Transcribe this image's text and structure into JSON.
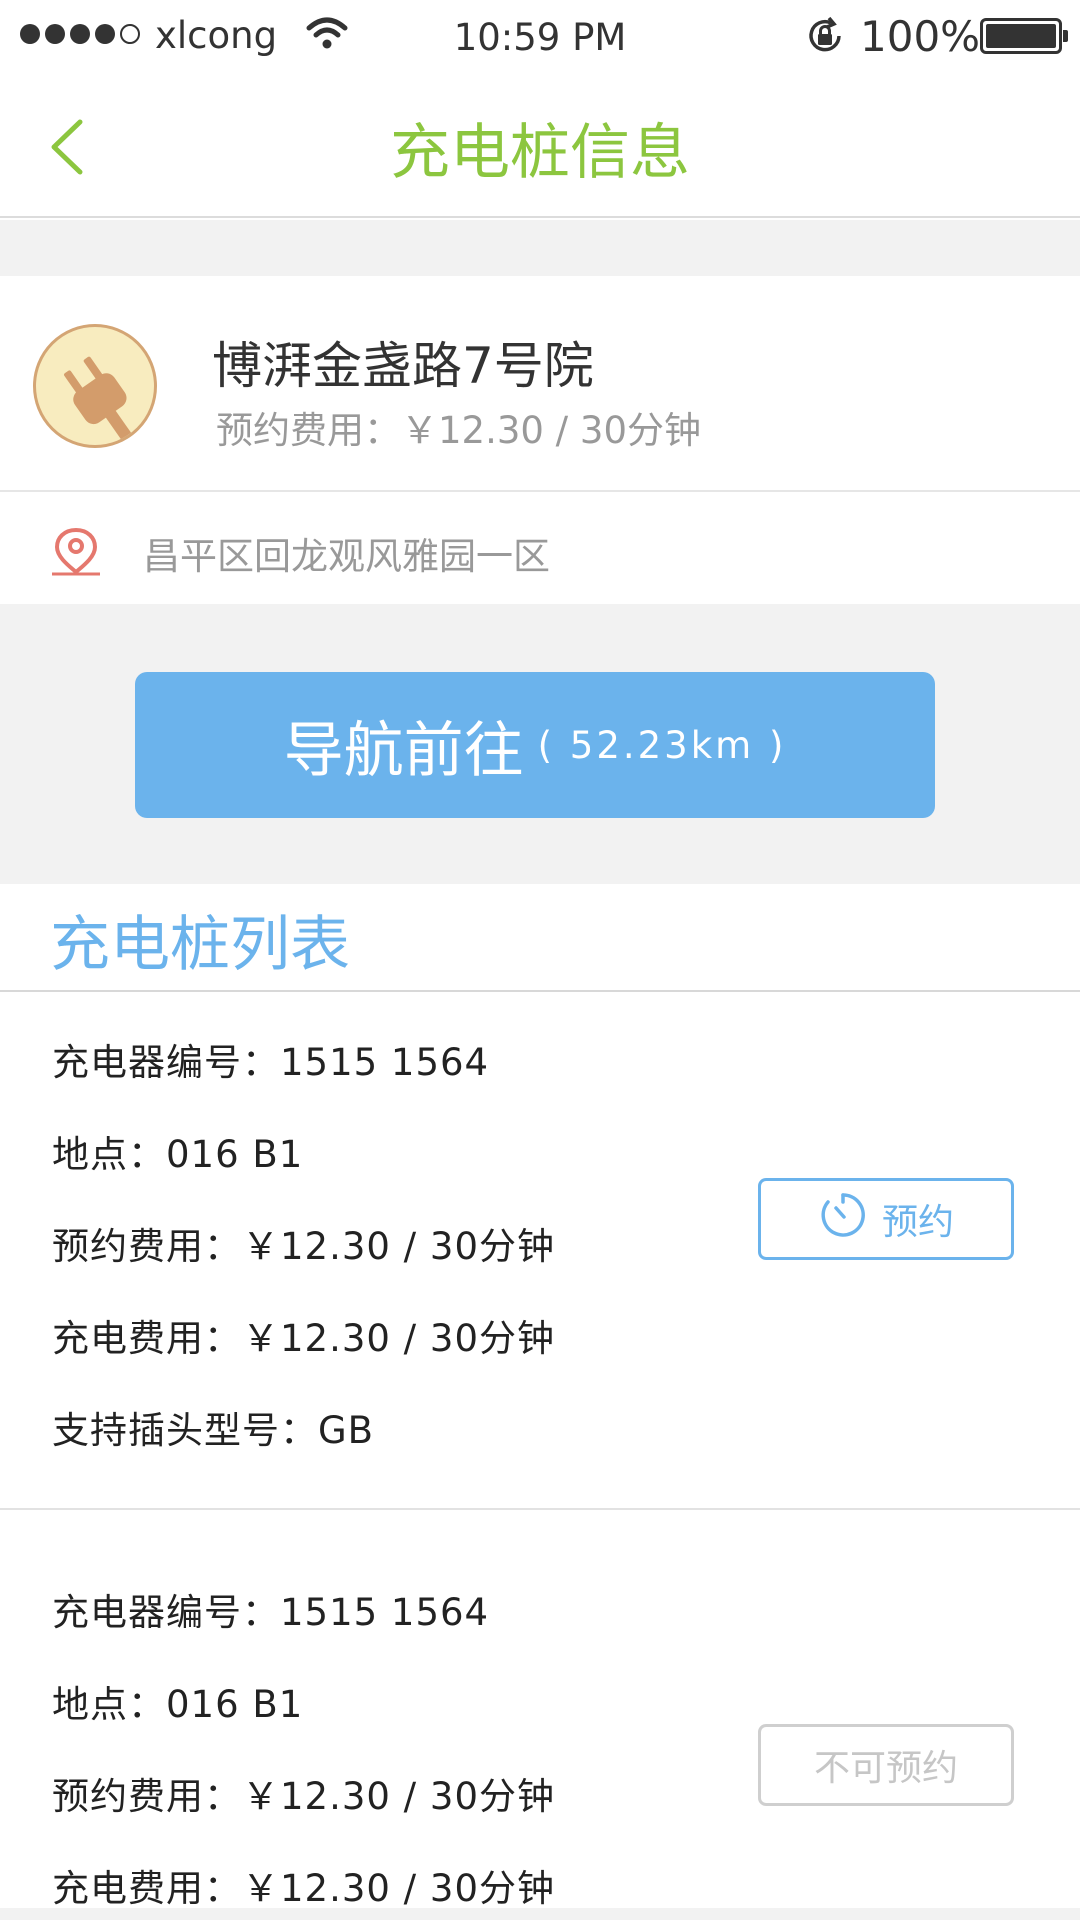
{
  "status_bar": {
    "carrier": "xlcong",
    "time": "10:59 PM",
    "battery": "100%"
  },
  "header": {
    "title": "充电桩信息"
  },
  "station": {
    "name": "博湃金盏路7号院",
    "reserve_fee": "预约费用：￥12.30  / 30分钟",
    "address": "昌平区回龙观风雅园一区",
    "icon": "plug-icon"
  },
  "navigate": {
    "label": "导航前往",
    "distance": "( 52.23km )"
  },
  "charger_list": {
    "title": "充电桩列表",
    "items": [
      {
        "charger_no": "充电器编号：1515  1564",
        "location": "地点：016  B1",
        "reserve_fee": "预约费用：￥12.30  / 30分钟",
        "charge_fee": "充电费用：￥12.30  / 30分钟",
        "plug_type": "支持插头型号：GB",
        "action_label": "预约"
      },
      {
        "charger_no": "充电器编号：1515  1564",
        "location": "地点：016  B1",
        "reserve_fee": "预约费用：￥12.30  / 30分钟",
        "charge_fee": "充电费用：￥12.30  / 30分钟",
        "action_label": "不可预约"
      }
    ]
  },
  "colors": {
    "title_green": "#8cc63f",
    "accent_blue": "#6bb3ec",
    "pin_red": "#e5786e"
  }
}
